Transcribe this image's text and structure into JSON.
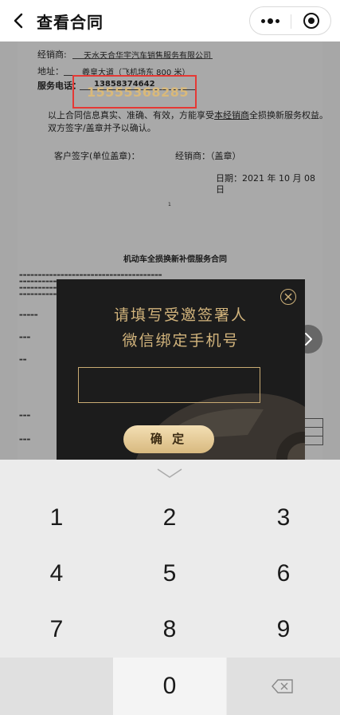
{
  "header": {
    "title": "查看合同",
    "back_icon": "back-arrow-icon",
    "more_icon": "more-dots-icon",
    "close_icon": "mini-program-close-icon"
  },
  "document": {
    "dealer_label": "经销商:",
    "dealer_value": "天水天合华宇汽车销售服务有限公司",
    "address_label": "地址：",
    "address_value": "羲皇大道（飞机场东 800 米）",
    "phone_label": "服务电话：",
    "phone_value": "13858374642",
    "overlay_phone": "15555368285",
    "confirm_line_1_a": "以上合同信息真实、准确、有效，方能享受",
    "confirm_line_1_b": "本经销商",
    "confirm_line_1_c": "全损换新服务权益。",
    "confirm_line_2": "双方签字/盖章并予以确认。",
    "customer_sign": "客户签字(单位盖章)：",
    "dealer_sign": "经销商：（盖章）",
    "date_label": "日期：2021 年 10 月 08",
    "date_day": "日",
    "page_mark": "1",
    "contract_title": "机动车全损换新补偿服务合同"
  },
  "modal": {
    "title_line_1": "请填写受邀签署人",
    "title_line_2": "微信绑定手机号",
    "input_value": "",
    "input_placeholder": "",
    "confirm_label": "确 定",
    "close_icon": "close-circle-icon",
    "accent_color": "#d2b47c"
  },
  "next_icon": "chevron-right-icon",
  "keyboard": {
    "keys": [
      "1",
      "2",
      "3",
      "4",
      "5",
      "6",
      "7",
      "8",
      "9",
      "0"
    ],
    "collapse_icon": "chevron-down-icon",
    "delete_icon": "backspace-icon"
  }
}
